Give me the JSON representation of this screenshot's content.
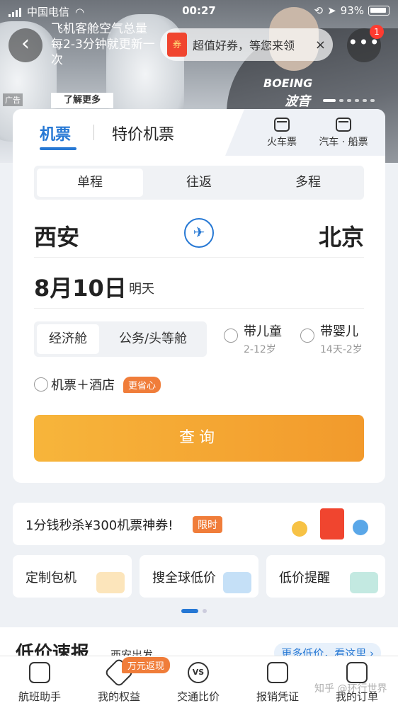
{
  "status_bar": {
    "carrier": "中国电信",
    "time": "00:27",
    "battery": "93%"
  },
  "banner": {
    "headline": "飞机客舱空气总量每2-3分钟就更新一次",
    "coupon_icon_text": "券",
    "coupon_text": "超值好券，等您来领",
    "coupon_close": "×",
    "notification_count": "1",
    "ad_label": "广告",
    "learn_more": "了解更多",
    "brand_en": "BOEING",
    "brand_cn": "波音"
  },
  "tabs": {
    "flight": "机票",
    "special": "特价机票",
    "train": "火车票",
    "bus": "汽车 · 船票"
  },
  "trip_types": [
    "单程",
    "往返",
    "多程"
  ],
  "route": {
    "from": "西安",
    "to": "北京",
    "swap_icon": "✈"
  },
  "date": {
    "main": "8月10日",
    "sub": "明天"
  },
  "cabin": [
    "经济舱",
    "公务/头等舱"
  ],
  "passengers": {
    "child_label": "带儿童",
    "child_age": "2-12岁",
    "infant_label": "带婴儿",
    "infant_age": "14天-2岁"
  },
  "combo": {
    "label": "机票＋酒店",
    "tag": "更省心"
  },
  "search_button": "查询",
  "promo": {
    "text": "1分钱秒杀¥300机票神券!",
    "tag": "限时"
  },
  "quick_links": [
    "定制包机",
    "搜全球低价",
    "低价提醒"
  ],
  "low_price": {
    "title": "低价速报",
    "city": "西安出发",
    "more": "更多低价，看这里 ›"
  },
  "bottom_nav": {
    "items": [
      "航班助手",
      "我的权益",
      "交通比价",
      "报销凭证",
      "我的订单"
    ],
    "badge": "万元返现",
    "vs_icon_text": "VS"
  },
  "watermark": "知乎 @环行世界",
  "colors": {
    "accent_blue": "#2678d4",
    "search_orange": "#f29a2c",
    "tag_orange": "#f07d3a",
    "badge_red": "#ff3b30"
  }
}
